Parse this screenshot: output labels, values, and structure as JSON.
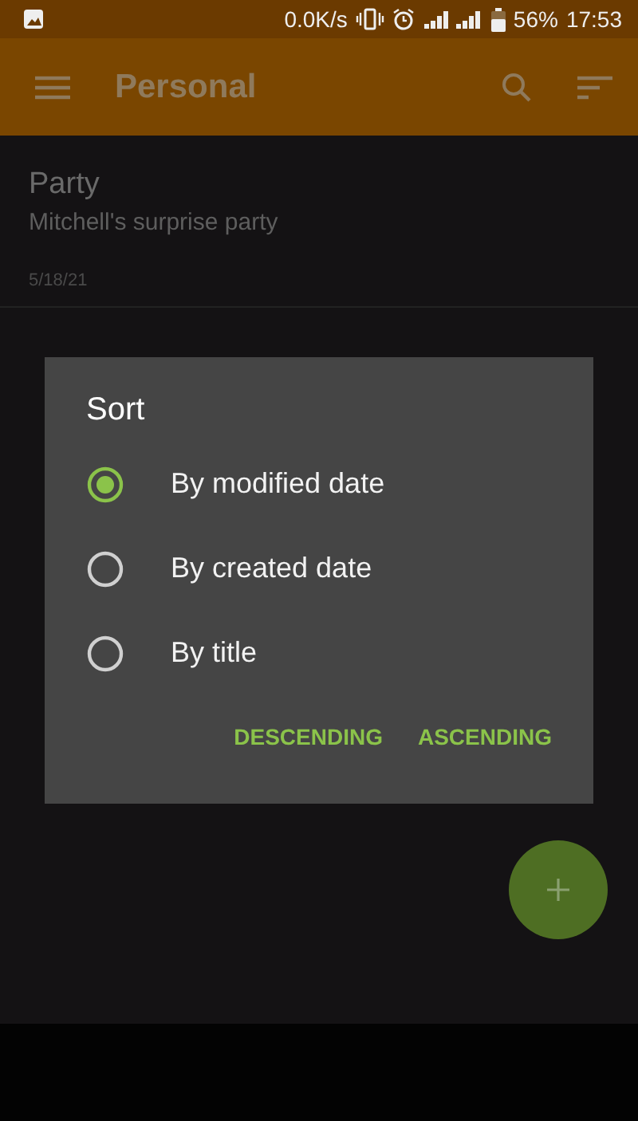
{
  "status_bar": {
    "speed": "0.0K/s",
    "battery": "56%",
    "time": "17:53"
  },
  "app_bar": {
    "title": "Personal"
  },
  "notes": [
    {
      "title": "Party",
      "body": "Mitchell's surprise party",
      "date": "5/18/21"
    }
  ],
  "dialog": {
    "title": "Sort",
    "options": [
      {
        "label": "By modified date",
        "selected": true
      },
      {
        "label": "By created date",
        "selected": false
      },
      {
        "label": "By title",
        "selected": false
      }
    ],
    "buttons": [
      "DESCENDING",
      "ASCENDING"
    ]
  }
}
